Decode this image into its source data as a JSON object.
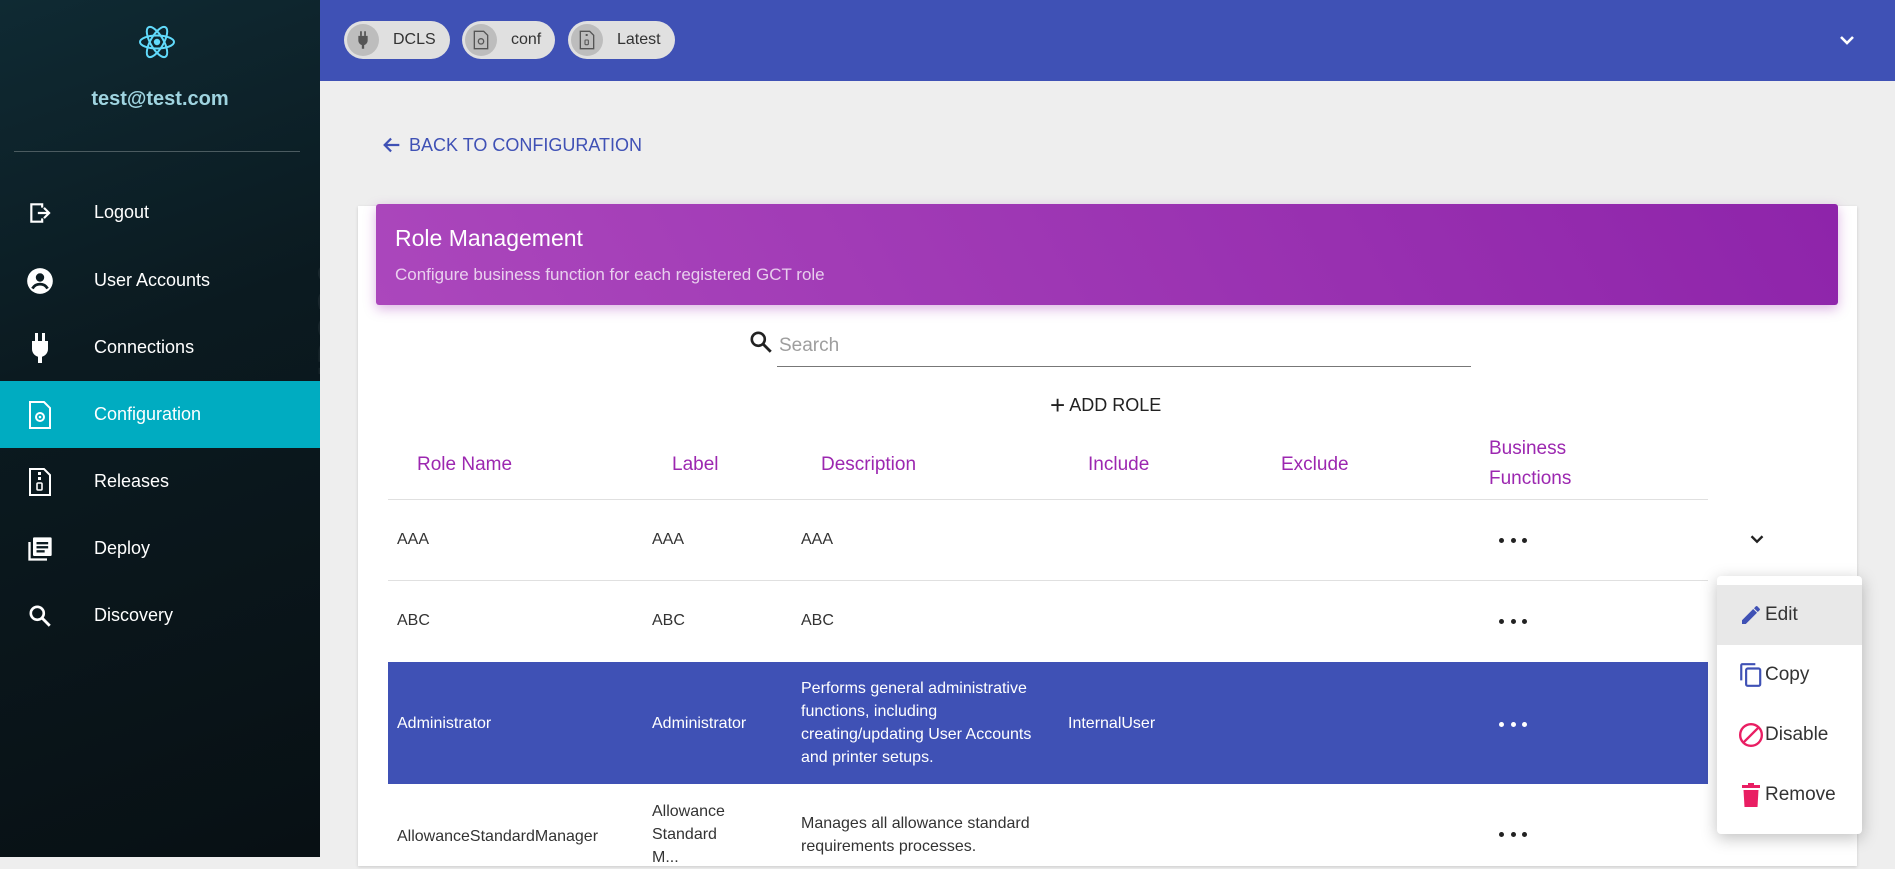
{
  "sidebar": {
    "user_email": "test@test.com",
    "items": [
      {
        "label": "Logout",
        "icon": "logout-icon"
      },
      {
        "label": "User Accounts",
        "icon": "account-circle-icon"
      },
      {
        "label": "Connections",
        "icon": "plug-icon"
      },
      {
        "label": "Configuration",
        "icon": "config-file-icon",
        "active": true
      },
      {
        "label": "Releases",
        "icon": "zip-file-icon"
      },
      {
        "label": "Deploy",
        "icon": "library-books-icon"
      },
      {
        "label": "Discovery",
        "icon": "search-icon"
      }
    ]
  },
  "header": {
    "chips": [
      {
        "label": "DCLS",
        "icon": "plug-icon"
      },
      {
        "label": "conf",
        "icon": "config-file-icon"
      },
      {
        "label": "Latest",
        "icon": "zip-file-icon"
      }
    ]
  },
  "main": {
    "back_label": "BACK TO CONFIGURATION",
    "card": {
      "title": "Role Management",
      "subtitle": "Configure business function for each registered GCT role"
    },
    "search": {
      "placeholder": "Search",
      "value": ""
    },
    "add_role_label": "ADD ROLE",
    "table": {
      "columns": [
        "Role Name",
        "Label",
        "Description",
        "Include",
        "Exclude",
        "Business",
        "Functions"
      ],
      "rows": [
        {
          "role": "AAA",
          "label": "AAA",
          "description": "AAA",
          "include": "",
          "exclude": ""
        },
        {
          "role": "ABC",
          "label": "ABC",
          "description": "ABC",
          "include": "",
          "exclude": ""
        },
        {
          "role": "Administrator",
          "label": "Administrator",
          "description_lines": [
            "Performs general administrative",
            "functions, including",
            "creating/updating User Accounts",
            "and printer setups."
          ],
          "include": "InternalUser",
          "exclude": "",
          "selected": true
        },
        {
          "role": "AllowanceStandardManager",
          "label_lines": [
            "Allowance",
            "Standard",
            "M..."
          ],
          "description_lines": [
            "Manages all allowance standard",
            "requirements processes."
          ],
          "include": "",
          "exclude": ""
        }
      ]
    }
  },
  "context_menu": {
    "items": [
      {
        "label": "Edit",
        "icon": "pencil-icon",
        "color": "#3f51b5"
      },
      {
        "label": "Copy",
        "icon": "copy-icon",
        "color": "#3f51b5"
      },
      {
        "label": "Disable",
        "icon": "block-icon",
        "color": "#e91e63"
      },
      {
        "label": "Remove",
        "icon": "trash-icon",
        "color": "#e91e63"
      }
    ]
  },
  "colors": {
    "primary": "#3f51b5",
    "accent_cyan": "#00acc1",
    "purple": "#9c27b0",
    "danger": "#e91e63"
  }
}
